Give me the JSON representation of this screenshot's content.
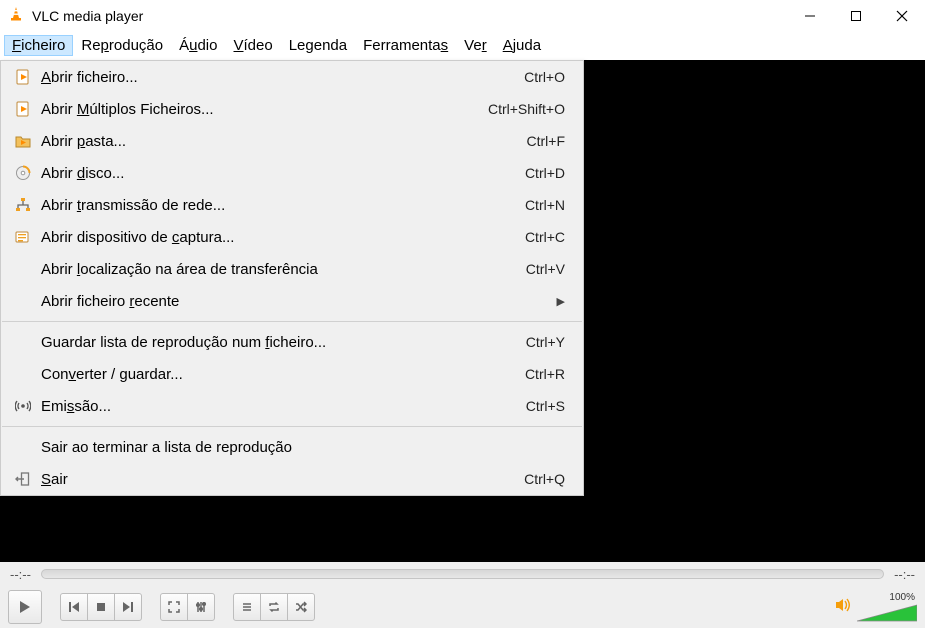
{
  "titlebar": {
    "title": "VLC media player"
  },
  "menubar": {
    "items": [
      {
        "pre": "",
        "m": "F",
        "post": "icheiro",
        "open": true
      },
      {
        "pre": "Re",
        "m": "p",
        "post": "rodução",
        "open": false
      },
      {
        "pre": "Á",
        "m": "u",
        "post": "dio",
        "open": false
      },
      {
        "pre": "",
        "m": "V",
        "post": "ídeo",
        "open": false
      },
      {
        "pre": "Le",
        "m": "g",
        "post": "enda",
        "open": false
      },
      {
        "pre": "Ferramenta",
        "m": "s",
        "post": "",
        "open": false
      },
      {
        "pre": "Ve",
        "m": "r",
        "post": "",
        "open": false
      },
      {
        "pre": "",
        "m": "A",
        "post": "juda",
        "open": false
      }
    ]
  },
  "dropdown": {
    "items": [
      {
        "icon": "file-play-icon",
        "pre": "",
        "m": "A",
        "post": "brir ficheiro...",
        "accel": "Ctrl+O",
        "sub": false
      },
      {
        "icon": "file-play-icon",
        "pre": "Abrir ",
        "m": "M",
        "post": "últiplos Ficheiros...",
        "accel": "Ctrl+Shift+O",
        "sub": false
      },
      {
        "icon": "folder-play-icon",
        "pre": "Abrir ",
        "m": "p",
        "post": "asta...",
        "accel": "Ctrl+F",
        "sub": false
      },
      {
        "icon": "disc-icon",
        "pre": "Abrir ",
        "m": "d",
        "post": "isco...",
        "accel": "Ctrl+D",
        "sub": false
      },
      {
        "icon": "network-icon",
        "pre": "Abrir ",
        "m": "t",
        "post": "ransmissão de rede...",
        "accel": "Ctrl+N",
        "sub": false
      },
      {
        "icon": "capture-icon",
        "pre": "Abrir dispositivo de ",
        "m": "c",
        "post": "aptura...",
        "accel": "Ctrl+C",
        "sub": false
      },
      {
        "icon": "",
        "pre": "Abrir ",
        "m": "l",
        "post": "ocalização na área de transferência",
        "accel": "Ctrl+V",
        "sub": false
      },
      {
        "icon": "",
        "pre": "Abrir ficheiro ",
        "m": "r",
        "post": "ecente",
        "accel": "",
        "sub": true
      },
      {
        "sep": true
      },
      {
        "icon": "",
        "pre": "Guardar lista de reprodução num ",
        "m": "f",
        "post": "icheiro...",
        "accel": "Ctrl+Y",
        "sub": false
      },
      {
        "icon": "",
        "pre": "Con",
        "m": "v",
        "post": "erter / guardar...",
        "accel": "Ctrl+R",
        "sub": false
      },
      {
        "icon": "stream-icon",
        "pre": "Emi",
        "m": "s",
        "post": "são...",
        "accel": "Ctrl+S",
        "sub": false
      },
      {
        "sep": true
      },
      {
        "icon": "",
        "pre": "Sair ao terminar a lista de reprodução",
        "m": "",
        "post": "",
        "accel": "",
        "sub": false
      },
      {
        "icon": "exit-icon",
        "pre": "",
        "m": "S",
        "post": "air",
        "accel": "Ctrl+Q",
        "sub": false
      }
    ]
  },
  "time": {
    "left": "--:--",
    "right": "--:--"
  },
  "volume": {
    "text": "100%"
  }
}
